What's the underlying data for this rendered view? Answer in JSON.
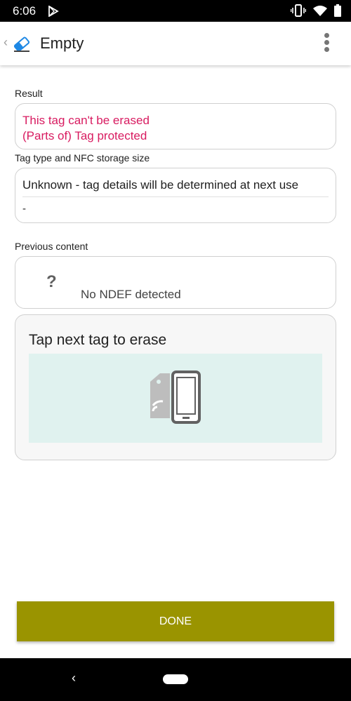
{
  "status_bar": {
    "time": "6:06"
  },
  "app_bar": {
    "title": "Empty",
    "back_glyph": "‹",
    "app_icon": "eraser-icon",
    "menu_icon": "overflow-menu-icon"
  },
  "result": {
    "label": "Result",
    "line1": "This tag can't be erased",
    "line2": "(Parts of) Tag protected"
  },
  "tag_type": {
    "label": "Tag type and NFC storage size",
    "line1": "Unknown - tag details will be determined at next use",
    "line2": "-"
  },
  "previous_content": {
    "label": "Previous content",
    "icon_glyph": "?",
    "text": "No NDEF detected"
  },
  "erase_panel": {
    "title": "Tap next tag to erase",
    "illustration": "nfc-phone-tag-icon"
  },
  "done_button": {
    "label": "DONE"
  },
  "colors": {
    "accent": "#9a9400",
    "error": "#d81b60",
    "erase_area": "#e0f2ef"
  }
}
